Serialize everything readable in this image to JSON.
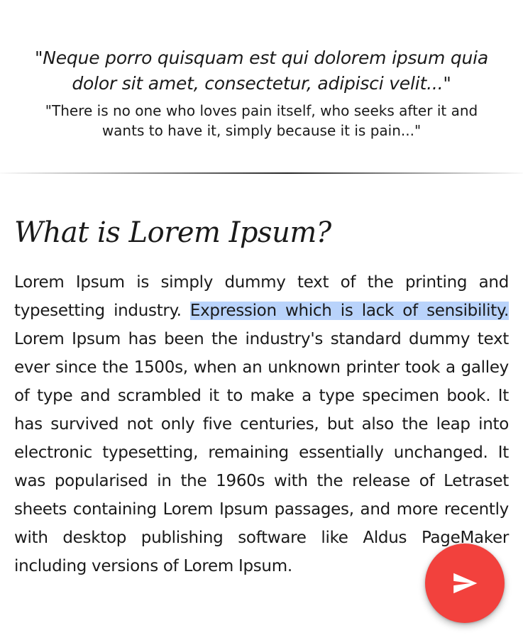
{
  "quote": {
    "latin": "\"Neque porro quisquam est qui dolorem ipsum quia dolor sit amet, consectetur, adipisci velit...\"",
    "english": "\"There is no one who loves pain itself, who seeks after it and wants to have it, simply because it is pain...\""
  },
  "article": {
    "title": "What is Lorem Ipsum?",
    "text_before": "Lorem Ipsum is simply dummy text of the printing and typesetting industry. ",
    "highlighted": "Expression which is lack of sensibility.",
    "text_after": " Lorem Ipsum has been the industry's standard dummy text ever since the 1500s, when an unknown printer took a galley of type and scrambled it to make a type specimen book. It has survived not only five centuries, but also the leap into electronic typesetting, remaining essentially unchanged. It was popularised in the 1960s with the release of Letraset sheets containing Lorem Ipsum passages, and more recently with desktop publishing software like Aldus PageMaker including versions of Lorem Ipsum."
  },
  "fab": {
    "icon": "send-icon",
    "color": "#f2413d"
  },
  "colors": {
    "highlight": "#b9d3fb"
  }
}
